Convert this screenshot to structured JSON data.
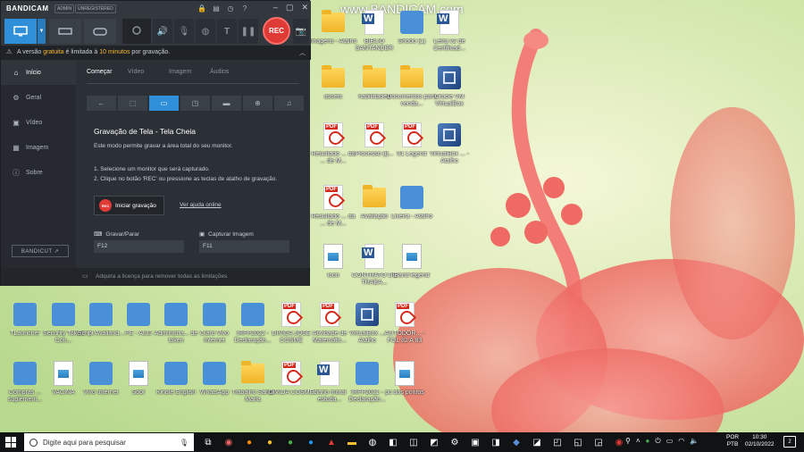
{
  "watermark": "www.BANDICAM.com",
  "bandicam": {
    "logo": "BANDICAM",
    "badge_admin": "ADMIN",
    "badge_unregistered": "UNREGISTERED",
    "rec_label": "REC",
    "notice": {
      "prefix": "A versão ",
      "highlight1": "gratuita",
      "middle": " é limitada à ",
      "highlight2": "10 minutos",
      "suffix": " por gravação."
    },
    "sidebar": [
      {
        "label": "Início",
        "icon": "home-icon"
      },
      {
        "label": "Geral",
        "icon": "gear-icon"
      },
      {
        "label": "Vídeo",
        "icon": "video-icon"
      },
      {
        "label": "Imagem",
        "icon": "image-icon"
      },
      {
        "label": "Sobre",
        "icon": "info-icon"
      }
    ],
    "bandicut": "BANDICUT ↗",
    "tabs": [
      "Começar",
      "Vídeo",
      "Imagem",
      "Áudios"
    ],
    "heading": "Gravação de Tela - Tela Cheia",
    "desc": "Este modo permite gravar a área total do seu monitor.",
    "step1": "1. Selecione um monitor que será capturado.",
    "step2": "2. Clique no botão 'REC' ou pressione as teclas de atalho de gravação.",
    "start_button": "Iniciar gravação",
    "help_link": "Ver ajuda online",
    "hotkey1_label": "Gravar/Parar",
    "hotkey1_value": "F12",
    "hotkey2_label": "Capturar Imagem",
    "hotkey2_value": "F11",
    "footer": "Adquira a licença para remover todas as limitações"
  },
  "desktop_icons": [
    {
      "label": "Imagens - Atalho",
      "type": "folder"
    },
    {
      "label": "BIBLIO SANTANDER",
      "type": "word"
    },
    {
      "label": "Shodo (1)",
      "type": "generic"
    },
    {
      "label": "Letra v2 de Certificad...",
      "type": "word"
    },
    {
      "label": "assets",
      "type": "folder"
    },
    {
      "label": "habilidades",
      "type": "folder"
    },
    {
      "label": "Documentos para venda...",
      "type": "folder"
    },
    {
      "label": "Oracle VM VirtualBox",
      "type": "vbox"
    },
    {
      "label": "Resultado ... da ... de M...",
      "type": "pdf"
    },
    {
      "label": "Processo (l)...",
      "type": "pdf"
    },
    {
      "label": "01 Legend",
      "type": "pdf"
    },
    {
      "label": "VirtualBox ... - Atalho",
      "type": "vbox"
    },
    {
      "label": "Resultado ... da ... de M...",
      "type": "pdf"
    },
    {
      "label": "Avaliação",
      "type": "folder"
    },
    {
      "label": "Lixeira - Atalho",
      "type": "generic"
    },
    {
      "label": "Icon",
      "type": "img"
    },
    {
      "label": "CONTRATO DE TRABA...",
      "type": "word"
    },
    {
      "label": "Band legend",
      "type": "img"
    },
    {
      "label": "TLauncher",
      "type": "generic"
    },
    {
      "label": "Security Token Con...",
      "type": "generic"
    },
    {
      "label": "Script Avaliand...",
      "type": "generic"
    },
    {
      "label": "PE - AUD",
      "type": "generic"
    },
    {
      "label": "Administra... de token",
      "type": "generic"
    },
    {
      "label": "Claro Vivo Internet",
      "type": "generic"
    },
    {
      "label": "IRPF2022 - Declaração...",
      "type": "generic"
    },
    {
      "label": "DIVIDA JOSÉ COSME",
      "type": "pdf"
    },
    {
      "label": "Atividade de Matemátic...",
      "type": "pdf"
    },
    {
      "label": "VirtualBox ... Atalho",
      "type": "vbox"
    },
    {
      "label": "AUTODOR... - FOL 82 A 83",
      "type": "pdf"
    },
    {
      "label": "Compras ... suplement...",
      "type": "generic"
    },
    {
      "label": "VACINA",
      "type": "img"
    },
    {
      "label": "Vivo Internet",
      "type": "generic"
    },
    {
      "label": "Sobr",
      "type": "img"
    },
    {
      "label": "Kindle English",
      "type": "generic"
    },
    {
      "label": "WhatsApp",
      "type": "generic"
    },
    {
      "label": "Trabalho Santa Maria",
      "type": "folder"
    },
    {
      "label": "DIVIDA COSME",
      "type": "pdf"
    },
    {
      "label": "diario moral estuda...",
      "type": "word"
    },
    {
      "label": "IRPF2021 - Declaração...",
      "type": "generic"
    },
    {
      "label": "pc dos pontos",
      "type": "img"
    }
  ],
  "taskbar": {
    "search_placeholder": "Digite aqui para pesquisar",
    "lang_line1": "POR",
    "lang_line2": "PTB",
    "time": "10:30",
    "date": "02/10/2022",
    "notifications": "2"
  },
  "colors": {
    "bandicam_accent": "#2f8fd8",
    "rec_red": "#e03a36",
    "notice_yellow": "#f5b82e"
  }
}
